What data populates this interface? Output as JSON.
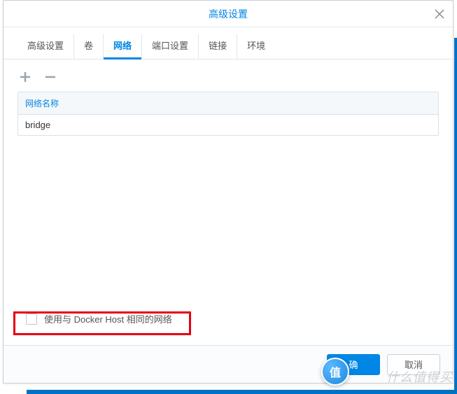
{
  "dialog": {
    "title": "高级设置"
  },
  "tabs": [
    {
      "label": "高级设置",
      "active": false
    },
    {
      "label": "卷",
      "active": false
    },
    {
      "label": "网络",
      "active": true
    },
    {
      "label": "端口设置",
      "active": false
    },
    {
      "label": "链接",
      "active": false
    },
    {
      "label": "环境",
      "active": false
    }
  ],
  "table": {
    "header": "网络名称",
    "rows": [
      "bridge"
    ]
  },
  "checkbox": {
    "label": "使用与 Docker Host 相同的网络",
    "checked": false
  },
  "buttons": {
    "confirm": "确",
    "cancel": "取消"
  },
  "badge": "值",
  "watermark": "什么值得买"
}
